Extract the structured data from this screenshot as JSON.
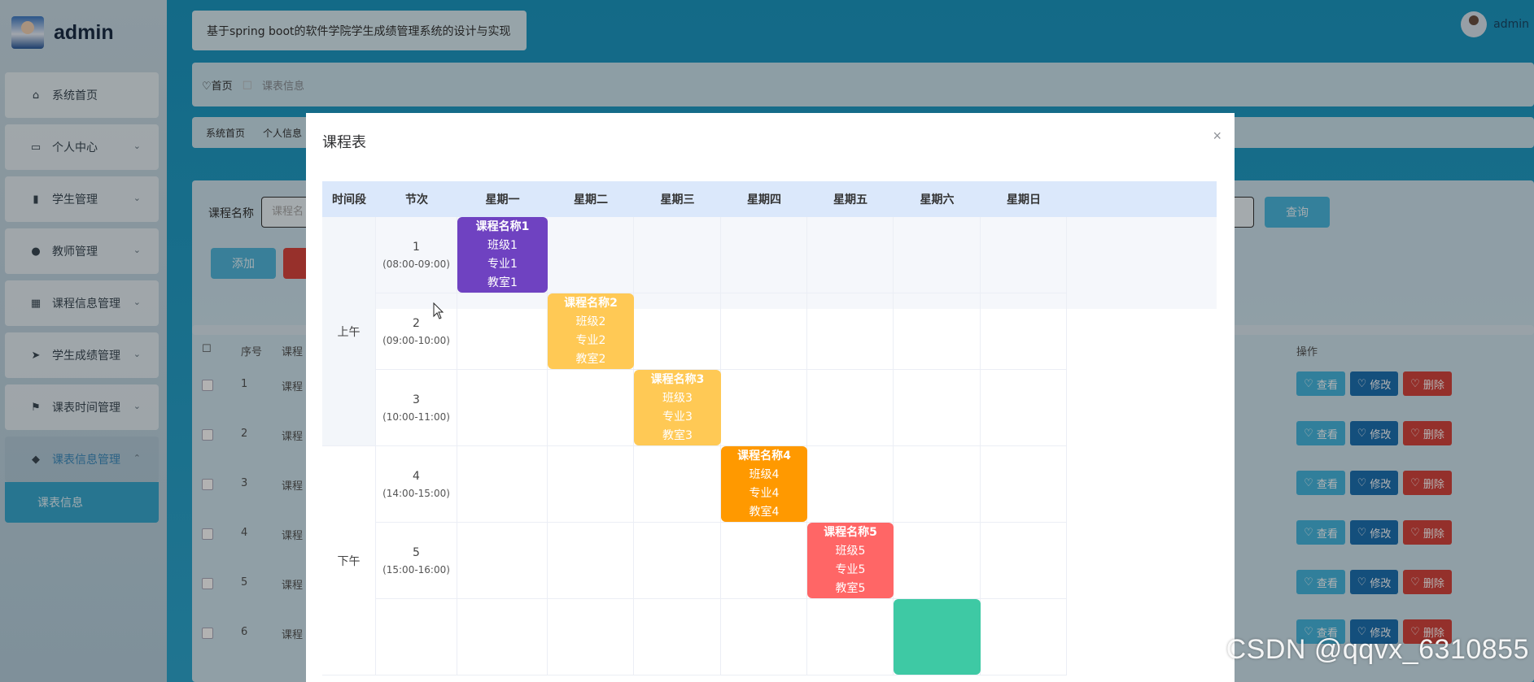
{
  "app": {
    "brand": "admin",
    "system_title": "基于spring boot的软件学院学生成绩管理系统的设计与实现",
    "user": "admin"
  },
  "sidebar": {
    "items": [
      {
        "label": "系统首页",
        "icon": "home-icon",
        "glyph": "⌂",
        "has_children": false
      },
      {
        "label": "个人中心",
        "icon": "card-icon",
        "glyph": "▭",
        "has_children": true
      },
      {
        "label": "学生管理",
        "icon": "books-icon",
        "glyph": "▮",
        "has_children": true
      },
      {
        "label": "教师管理",
        "icon": "person-icon",
        "glyph": "●",
        "has_children": true
      },
      {
        "label": "课程信息管理",
        "icon": "grid-icon",
        "glyph": "▦",
        "has_children": true
      },
      {
        "label": "学生成绩管理",
        "icon": "send-icon",
        "glyph": "➤",
        "has_children": true
      },
      {
        "label": "课表时间管理",
        "icon": "flag-icon",
        "glyph": "⚑",
        "has_children": true
      },
      {
        "label": "课表信息管理",
        "icon": "leaf-icon",
        "glyph": "◆",
        "has_children": true,
        "expanded": true
      }
    ],
    "sub_item": "课表信息"
  },
  "breadcrumb": {
    "home": "首页",
    "current": "课表信息"
  },
  "tags": [
    "系统首页",
    "个人信息"
  ],
  "search": {
    "label": "课程名称",
    "placeholder": "课程名",
    "query_button": "查询",
    "add_button": "添加"
  },
  "table": {
    "headers": {
      "index": "序号",
      "name": "课程",
      "actions": "操作"
    },
    "rows": [
      {
        "index": "1",
        "name": "课程"
      },
      {
        "index": "2",
        "name": "课程"
      },
      {
        "index": "3",
        "name": "课程"
      },
      {
        "index": "4",
        "name": "课程"
      },
      {
        "index": "5",
        "name": "课程"
      },
      {
        "index": "6",
        "name": "课程"
      }
    ],
    "actions": {
      "view": "查看",
      "edit": "修改",
      "delete": "删除"
    }
  },
  "modal": {
    "title": "课程表",
    "close": "×",
    "headers": [
      "时间段",
      "节次",
      "星期一",
      "星期二",
      "星期三",
      "星期四",
      "星期五",
      "星期六",
      "星期日"
    ],
    "periods": [
      {
        "label": "上午",
        "slots": 3
      },
      {
        "label": "下午",
        "slots": 3
      }
    ],
    "slots": [
      {
        "num": "1",
        "time": "(08:00-09:00)"
      },
      {
        "num": "2",
        "time": "(09:00-10:00)"
      },
      {
        "num": "3",
        "time": "(10:00-11:00)"
      },
      {
        "num": "4",
        "time": "(14:00-15:00)"
      },
      {
        "num": "5",
        "time": "(15:00-16:00)"
      }
    ],
    "courses": [
      {
        "slot": 1,
        "day": 1,
        "name": "课程名称1",
        "class": "班级1",
        "major": "专业1",
        "room": "教室1",
        "color": "#6f42c1"
      },
      {
        "slot": 2,
        "day": 2,
        "name": "课程名称2",
        "class": "班级2",
        "major": "专业2",
        "room": "教室2",
        "color": "#ffc955"
      },
      {
        "slot": 3,
        "day": 3,
        "name": "课程名称3",
        "class": "班级3",
        "major": "专业3",
        "room": "教室3",
        "color": "#ffc955"
      },
      {
        "slot": 4,
        "day": 4,
        "name": "课程名称4",
        "class": "班级4",
        "major": "专业4",
        "room": "教室4",
        "color": "#ff9900"
      },
      {
        "slot": 5,
        "day": 5,
        "name": "课程名称5",
        "class": "班级5",
        "major": "专业5",
        "room": "教室5",
        "color": "#ff6666"
      },
      {
        "slot": 6,
        "day": 6,
        "color": "#3ec9a4"
      }
    ]
  },
  "watermark": "CSDN @qqvx_6310855"
}
